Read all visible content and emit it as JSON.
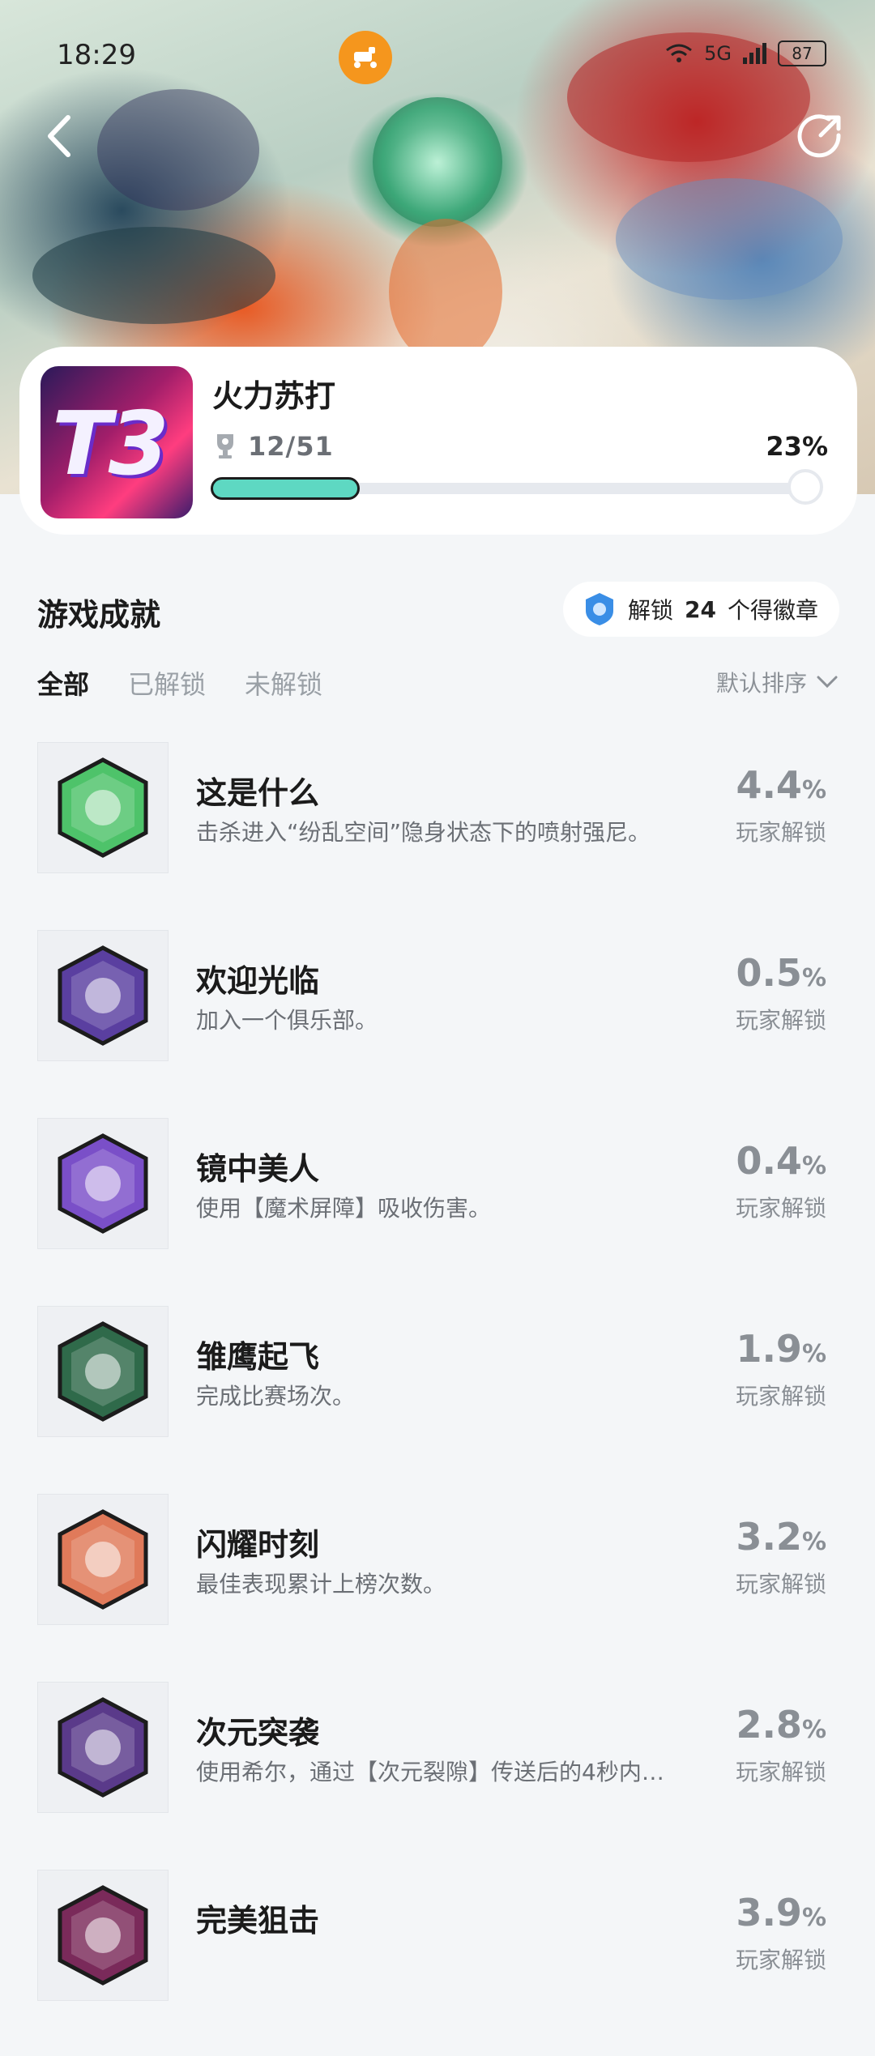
{
  "status_bar": {
    "time": "18:29",
    "network": "5G",
    "battery": "87"
  },
  "game": {
    "title": "火力苏打",
    "logo_text": "T3",
    "achievements_count": "12/51",
    "progress_percent_label": "23%",
    "progress_fraction": 0.23
  },
  "section": {
    "title": "游戏成就",
    "badge_prefix": "解锁",
    "badge_count": "24",
    "badge_suffix": "个得徽章"
  },
  "tabs": [
    {
      "label": "全部",
      "active": true
    },
    {
      "label": "已解锁",
      "active": false
    },
    {
      "label": "未解锁",
      "active": false
    }
  ],
  "sort": {
    "label": "默认排序"
  },
  "achievements": [
    {
      "title": "这是什么",
      "desc": "击杀进入“纷乱空间”隐身状态下的喷射强尼。",
      "rate": "4.4",
      "unit": "%",
      "rate_label": "玩家解锁",
      "icon": "gingerbread-badge-icon",
      "color": "#4ec36a"
    },
    {
      "title": "欢迎光临",
      "desc": "加入一个俱乐部。",
      "rate": "0.5",
      "unit": "%",
      "rate_label": "玩家解锁",
      "icon": "beer-cheers-badge-icon",
      "color": "#5a3fa0"
    },
    {
      "title": "镜中美人",
      "desc": "使用【魔术屏障】吸收伤害。",
      "rate": "0.4",
      "unit": "%",
      "rate_label": "玩家解锁",
      "icon": "magician-portrait-badge-icon",
      "color": "#7a4fc8"
    },
    {
      "title": "雏鹰起飞",
      "desc": "完成比赛场次。",
      "rate": "1.9",
      "unit": "%",
      "rate_label": "玩家解锁",
      "icon": "bird-sunglasses-badge-icon",
      "color": "#2f6a4a"
    },
    {
      "title": "闪耀时刻",
      "desc": "最佳表现累计上榜次数。",
      "rate": "3.2",
      "unit": "%",
      "rate_label": "玩家解锁",
      "icon": "star-badge-icon",
      "color": "#e07a5a"
    },
    {
      "title": "次元突袭",
      "desc": "使用希尔，通过【次元裂隙】传送后的4秒内…",
      "rate": "2.8",
      "unit": "%",
      "rate_label": "玩家解锁",
      "icon": "lightning-girl-badge-icon",
      "color": "#5a3a8a"
    },
    {
      "title": "完美狙击",
      "desc": "",
      "rate": "3.9",
      "unit": "%",
      "rate_label": "玩家解锁",
      "icon": "sniper-badge-icon",
      "color": "#7a2a5a"
    }
  ]
}
